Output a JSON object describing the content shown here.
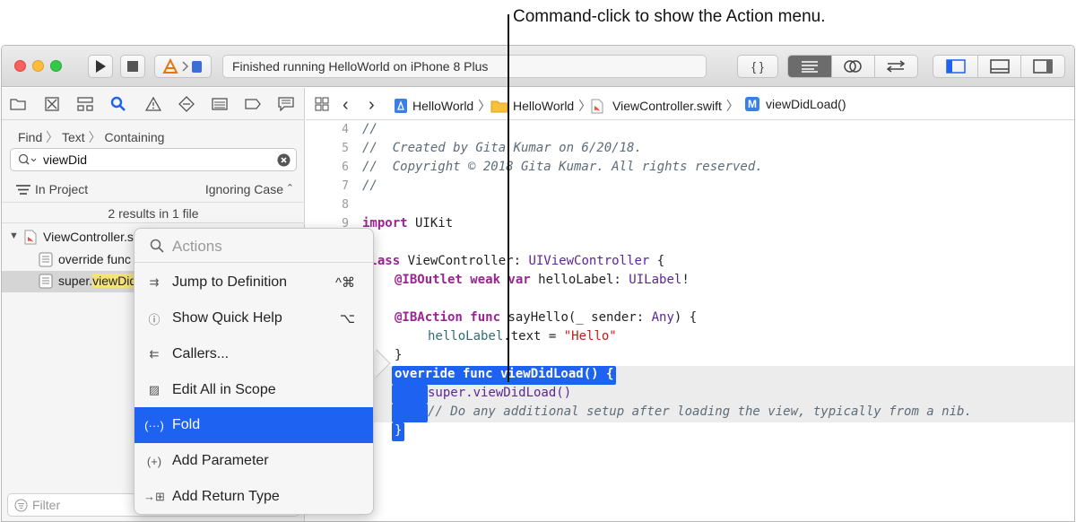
{
  "callout": "Command-click to show the Action menu.",
  "toolbar": {
    "status_text": "Finished running HelloWorld on iPhone 8 Plus",
    "buttons": [
      "run-icon",
      "stop-icon",
      "scheme-icon",
      "braces-icon",
      "standard-editor-icon",
      "assistant-editor-icon",
      "version-editor-icon",
      "navigator-toggle-icon",
      "debug-toggle-icon",
      "inspector-toggle-icon"
    ],
    "braces_label": "{ }"
  },
  "navigator": {
    "tabs": [
      "folder-icon",
      "source-control-icon",
      "hierarchy-icon",
      "search-icon",
      "warning-icon",
      "test-icon",
      "debug-icon",
      "breakpoint-icon",
      "report-icon"
    ],
    "find_crumb": [
      "Find",
      "Text",
      "Containing"
    ],
    "search_value": "viewDid",
    "scope": "In Project",
    "case_mode": "Ignoring Case",
    "results_summary": "2 results in 1 file",
    "results": [
      {
        "label": "ViewController.swift",
        "visible": "ViewController.s"
      },
      {
        "label": "override func viewDidLoad() {",
        "visible": "override func"
      },
      {
        "prefix": "super.",
        "match": "viewDid"
      }
    ],
    "filter_placeholder": "Filter"
  },
  "jumpbar": {
    "items": [
      "HelloWorld",
      "HelloWorld",
      "ViewController.swift",
      "viewDidLoad()"
    ],
    "method_badge": "M"
  },
  "code": {
    "line_numbers": [
      "4",
      "5",
      "6",
      "7",
      "8",
      "9"
    ],
    "lines": {
      "l4": "//",
      "l5": "//  Created by Gita Kumar on 6/20/18.",
      "l6": "//  Copyright © 2018 Gita Kumar. All rights reserved.",
      "l7": "//",
      "l9_kw": "import",
      "l9_rest": " UIKit",
      "l11_kw": "class",
      "l11_name": " ViewController: ",
      "l11_type": "UIViewController",
      "l11_end": " {",
      "l12_attr": "@IBOutlet",
      "l12_kw": " weak var",
      "l12_name": " helloLabel: ",
      "l12_type": "UILabel",
      "l12_end": "!",
      "l14_attr": "@IBAction",
      "l14_kw": " func",
      "l14_name": " sayHello(_ sender: ",
      "l14_type": "Any",
      "l14_end": ") {",
      "l15_a": "helloLabel",
      "l15_b": ".text = ",
      "l15_str": "\"Hello\"",
      "l16": "}",
      "l17": "override func viewDidLoad() {",
      "l18": "super.viewDidLoad()",
      "l19": "// Do any additional setup after loading the view, typically from a nib.",
      "l20": "}"
    }
  },
  "action_menu": {
    "search_placeholder": "Actions",
    "items": [
      {
        "label": "Jump to Definition",
        "shortcut": "^⌘",
        "icon": "jump-definition-icon"
      },
      {
        "label": "Show Quick Help",
        "shortcut": "⌥",
        "icon": "quick-help-icon"
      },
      {
        "label": "Callers...",
        "shortcut": "",
        "icon": "callers-icon"
      },
      {
        "label": "Edit All in Scope",
        "shortcut": "",
        "icon": "edit-scope-icon"
      },
      {
        "label": "Fold",
        "shortcut": "",
        "icon": "fold-icon",
        "selected": true
      },
      {
        "label": "Add Parameter",
        "shortcut": "",
        "icon": "add-parameter-icon"
      },
      {
        "label": "Add Return Type",
        "shortcut": "",
        "icon": "add-return-type-icon"
      }
    ]
  },
  "colors": {
    "selection": "#1d62f0",
    "keyword": "#9b2393",
    "type": "#5c2699",
    "comment": "#5d6c79",
    "string": "#c41a16"
  }
}
